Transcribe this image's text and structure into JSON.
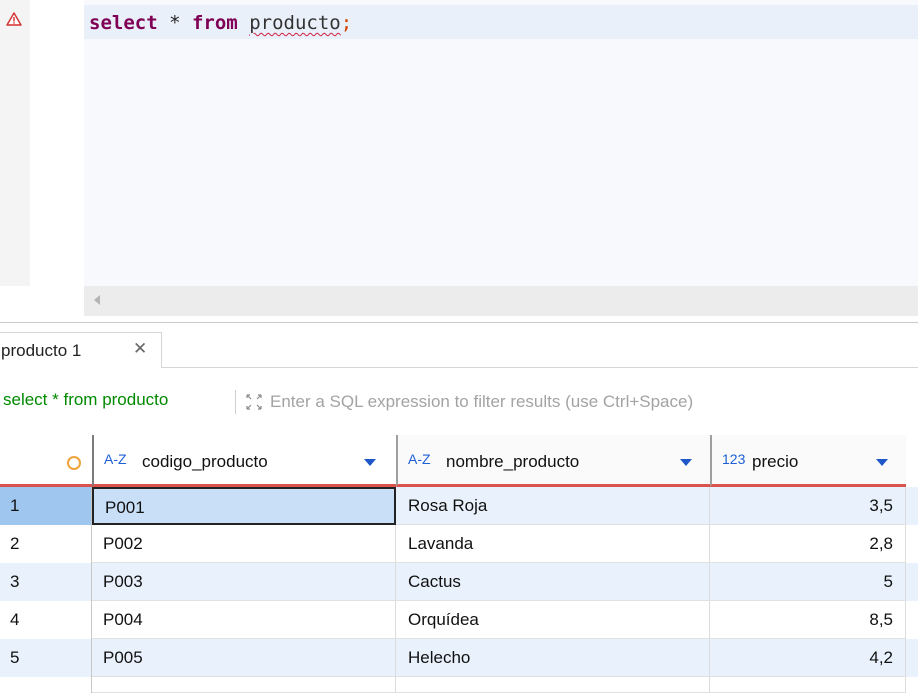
{
  "editor": {
    "sql_keyword_select": "select",
    "sql_star": " * ",
    "sql_keyword_from": "from",
    "sql_space": " ",
    "sql_table": "producto",
    "sql_semicolon": ";",
    "gutter_icon": "warning-icon",
    "colors": {
      "keyword": "#7f0055",
      "semicolon": "#d24400",
      "error_underline": "#d11f3f",
      "current_line": "#e9f0fa"
    }
  },
  "results_tab": {
    "label": "producto 1",
    "close_glyph": "✕"
  },
  "filter_bar": {
    "query_text": "select * from producto",
    "placeholder": "Enter a SQL expression to filter results (use Ctrl+Space)",
    "value": ""
  },
  "grid": {
    "columns": [
      {
        "type_badge": "A-Z",
        "name": "codigo_producto"
      },
      {
        "type_badge": "A-Z",
        "name": "nombre_producto"
      },
      {
        "type_badge": "123",
        "name": "precio"
      }
    ],
    "rows": [
      {
        "num": "1",
        "codigo_producto": "P001",
        "nombre_producto": "Rosa Roja",
        "precio": "3,5"
      },
      {
        "num": "2",
        "codigo_producto": "P002",
        "nombre_producto": "Lavanda",
        "precio": "2,8"
      },
      {
        "num": "3",
        "codigo_producto": "P003",
        "nombre_producto": "Cactus",
        "precio": "5"
      },
      {
        "num": "4",
        "codigo_producto": "P004",
        "nombre_producto": "Orquídea",
        "precio": "8,5"
      },
      {
        "num": "5",
        "codigo_producto": "P005",
        "nombre_producto": "Helecho",
        "precio": "4,2"
      }
    ],
    "colors": {
      "header_underline": "#d9534f",
      "alt_row": "#e9f2fc",
      "selected_row_num": "#9ec6ef",
      "type_badge": "#1f5fd6"
    }
  }
}
